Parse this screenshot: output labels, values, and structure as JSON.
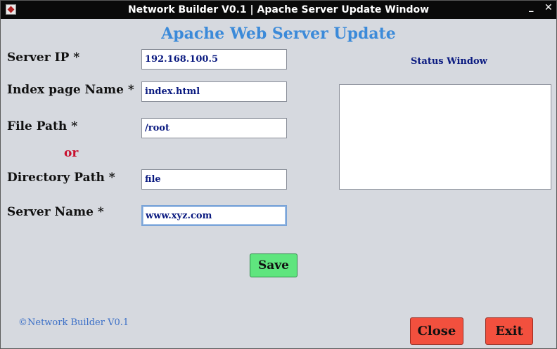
{
  "window": {
    "title": "Network Builder V0.1 | Apache Server Update Window",
    "minimize_glyph": "_",
    "maximize_glyph": "□",
    "close_glyph": "✕"
  },
  "heading": "Apache Web Server Update",
  "form": {
    "server_ip_label": "Server IP *",
    "server_ip_value": "192.168.100.5",
    "index_page_label": "Index page Name *",
    "index_page_value": "index.html",
    "file_path_label": "File Path *",
    "file_path_value": "/root",
    "or_label": "or",
    "directory_path_label": "Directory Path *",
    "directory_path_value": "file",
    "server_name_label": "Server Name *",
    "server_name_value": "www.xyz.com"
  },
  "status": {
    "label": "Status Window",
    "content": ""
  },
  "buttons": {
    "save": "Save",
    "close": "Close",
    "exit": "Exit"
  },
  "footer": "©Network Builder V0.1",
  "icons": {
    "app": "java-app-icon"
  },
  "colors": {
    "heading": "#3b8ad9",
    "or_label": "#c8102e",
    "save_button": "#5fe57e",
    "close_button": "#f2503e",
    "exit_button": "#f2503e",
    "field_text": "#0a1a80"
  }
}
